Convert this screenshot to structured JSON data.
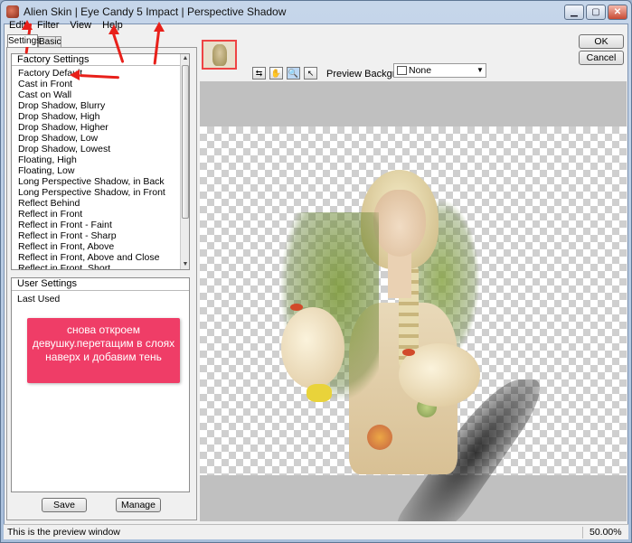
{
  "window": {
    "title": "Alien Skin | Eye Candy 5 Impact | Perspective Shadow",
    "min_glyph": "▁",
    "max_glyph": "▢",
    "close_glyph": "✕"
  },
  "menu": [
    "Edit",
    "Filter",
    "View",
    "Help"
  ],
  "tabs": {
    "settings": "Settings",
    "basic": "Basic"
  },
  "factory": {
    "header": "Factory Settings",
    "items": [
      "Factory Default",
      "Cast in Front",
      "Cast on Wall",
      "Drop Shadow, Blurry",
      "Drop Shadow, High",
      "Drop Shadow, Higher",
      "Drop Shadow, Low",
      "Drop Shadow, Lowest",
      "Floating, High",
      "Floating, Low",
      "Long Perspective Shadow, in Back",
      "Long Perspective Shadow, in Front",
      "Reflect Behind",
      "Reflect in Front",
      "Reflect in Front - Faint",
      "Reflect in Front - Sharp",
      "Reflect in Front, Above",
      "Reflect in Front, Above and Close",
      "Reflect in Front, Short"
    ]
  },
  "user": {
    "header": "User Settings",
    "items": [
      "Last Used"
    ]
  },
  "buttons": {
    "save": "Save",
    "manage": "Manage",
    "ok": "OK",
    "cancel": "Cancel"
  },
  "preview": {
    "background_label": "Preview Background:",
    "background_value": "None"
  },
  "tools": {
    "compare": "⇆",
    "hand": "✋",
    "zoom": "🔍",
    "arrow": "↖"
  },
  "note": "снова откроем девушку.перетащим в слоях наверх и добавим тень",
  "status": {
    "text": "This is the preview window",
    "zoom": "50.00%"
  },
  "colors": {
    "note_bg": "#ef3d67",
    "annotation_arrow": "#e8201a"
  }
}
